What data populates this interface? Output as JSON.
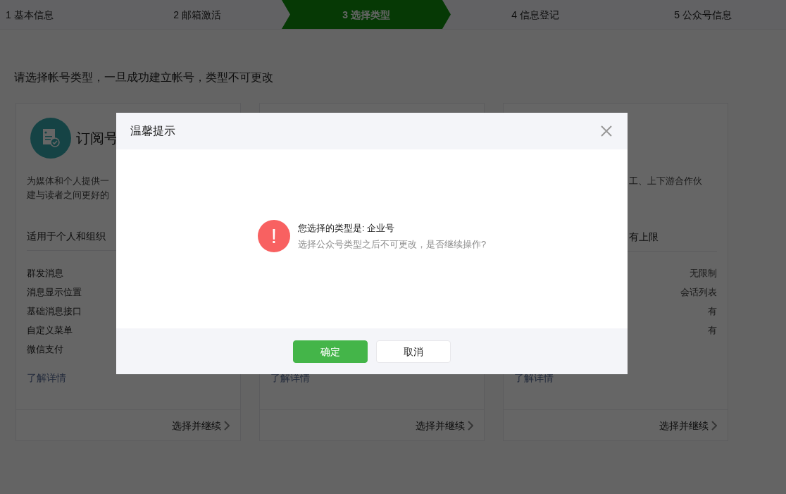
{
  "steps": [
    {
      "label": "1 基本信息",
      "selected": false
    },
    {
      "label": "2 邮箱激活",
      "selected": false
    },
    {
      "label": "3 选择类型",
      "selected": true
    },
    {
      "label": "4 信息登记",
      "selected": false
    },
    {
      "label": "5 公众号信息",
      "selected": false
    }
  ],
  "intro": "请选择帐号类型，一旦成功建立帐号，类型不可更改",
  "cards": [
    {
      "title": "订阅号",
      "description": [
        "为媒体和个人提供一",
        "建与读者之间更好的"
      ],
      "scope": "适用于个人和组织",
      "features": [
        {
          "name": "群发消息"
        },
        {
          "name": "消息显示位置"
        },
        {
          "name": "基础消息接口"
        },
        {
          "name": "自定义菜单"
        },
        {
          "name": "微信支付"
        }
      ],
      "link": "了解详情",
      "action": "选择并继续"
    },
    {
      "link": "了解详情",
      "action": "选择并继续"
    },
    {
      "description": [
        "工、上下游合作伙"
      ],
      "scope": "有上限",
      "features": [
        {
          "value": "无限制"
        },
        {
          "value": "会话列表"
        },
        {
          "value": "有"
        },
        {
          "value": "有"
        }
      ],
      "link": "了解详情",
      "action": "选择并继续"
    }
  ],
  "dialog": {
    "title": "温馨提示",
    "icon": "!",
    "message": "您选择的类型是: 企业号",
    "detail": "选择公众号类型之后不可更改，是否继续操作?",
    "buttons": [
      {
        "label": "确定",
        "kind": "primary"
      },
      {
        "label": "取消",
        "kind": "default"
      }
    ]
  }
}
